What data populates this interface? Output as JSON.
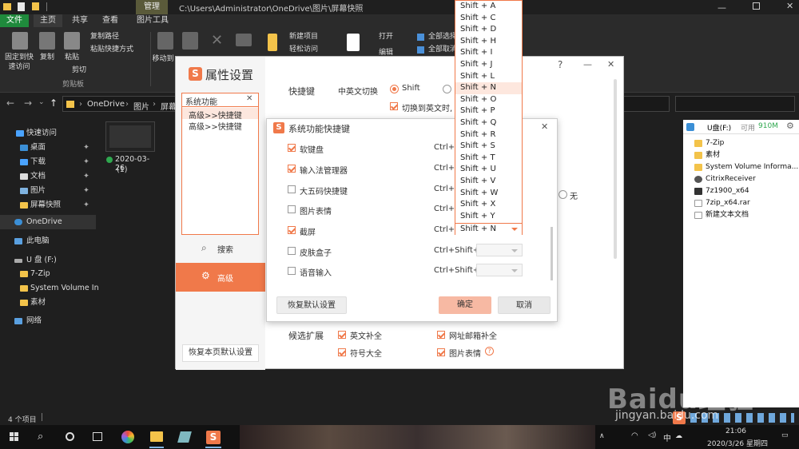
{
  "explorer": {
    "title_path": "C:\\Users\\Administrator\\OneDrive\\图片\\屏幕快照",
    "context_tab": "管理",
    "tabs": [
      "文件",
      "主页",
      "共享",
      "查看",
      "图片工具"
    ],
    "ribbon": {
      "pin_quick": "固定到快\n速访问",
      "copy": "复制",
      "paste": "粘贴",
      "copy_path": "复制路径",
      "paste_shortcut": "粘贴快捷方式",
      "cut": "剪切",
      "group_clipboard": "剪贴板",
      "move_to": "移动到",
      "new_item": "新建项目",
      "easy_access": "轻松访问",
      "open": "打开",
      "edit": "编辑",
      "select_all": "全部选择",
      "select_none": "全部取消"
    },
    "breadcrumb": [
      "OneDrive",
      "图片",
      "屏幕"
    ],
    "nav": {
      "quick_access": "快速访问",
      "desktop": "桌面",
      "downloads": "下载",
      "documents": "文档",
      "pictures": "图片",
      "screenshots": "屏幕快照",
      "onedrive": "OneDrive",
      "this_pc": "此电脑",
      "udisk": "U 盘 (F:)",
      "zip": "7-Zip",
      "svi": "System Volume In",
      "material": "素材",
      "network": "网络"
    },
    "file": {
      "name": "2020-03-26",
      "suffix": "(1)"
    },
    "status": "4 个项目"
  },
  "udisk_panel": {
    "title": "U盘(F:)",
    "free_label": "可用",
    "free": "910M",
    "items": [
      "7-Zip",
      "素材",
      "System Volume Informa...",
      "CitrixReceiver",
      "7z1900_x64",
      "7zip_x64.rar",
      "新建文本文档"
    ]
  },
  "sogou": {
    "title": "属性设置",
    "search_value": "系统功能",
    "results": [
      "高级>>快捷键",
      "高级>>快捷键"
    ],
    "nav_search": "搜索",
    "nav_advanced": "高级",
    "restore_page": "恢复本页默认设置",
    "hotkey_label": "快捷键",
    "switch_label": "中英文切换",
    "shift_option": "Shift",
    "switch_note": "切换到英文时,",
    "none_option": "无",
    "candidate_label": "候选扩展",
    "cand": [
      "英文补全",
      "网址邮箱补全",
      "符号大全",
      "图片表情"
    ],
    "help": "?",
    "minimize": "—",
    "close": "✕"
  },
  "dialog": {
    "title": "系统功能快捷键",
    "close": "✕",
    "rows": [
      {
        "label": "软键盘",
        "checked": true,
        "combo": "Ctrl+S"
      },
      {
        "label": "输入法管理器",
        "checked": true,
        "combo": "Ctrl+S"
      },
      {
        "label": "大五码快捷键",
        "checked": false,
        "combo": "Ctrl+S"
      },
      {
        "label": "图片表情",
        "checked": false,
        "combo": "Ctrl+S"
      },
      {
        "label": "截屏",
        "checked": true,
        "combo": "Ctrl+"
      },
      {
        "label": "皮肤盒子",
        "checked": false,
        "combo": "Ctrl+Shift+"
      },
      {
        "label": "语音输入",
        "checked": false,
        "combo": "Ctrl+Shift+"
      }
    ],
    "selected_value": "Shift + N",
    "restore": "恢复默认设置",
    "ok": "确定",
    "cancel": "取消"
  },
  "dropdown": {
    "options": [
      "Shift + A",
      "Shift + C",
      "Shift + D",
      "Shift + H",
      "Shift + I",
      "Shift + J",
      "Shift + L",
      "Shift + N",
      "Shift + O",
      "Shift + P",
      "Shift + Q",
      "Shift + R",
      "Shift + S",
      "Shift + T",
      "Shift + U",
      "Shift + V",
      "Shift + W",
      "Shift + X",
      "Shift + Y"
    ],
    "highlighted": "Shift + N"
  },
  "taskbar": {
    "ime_tray": "中",
    "time": "21:06",
    "date": "2020/3/26 星期四"
  },
  "watermark": {
    "brand": "Baidu经验",
    "url": "jingyan.baidu.com"
  },
  "colors": {
    "accent": "#f0794a",
    "explorer_bg": "#1f1f1f",
    "dark_ribbon": "#2b2b2b",
    "udisk_free": "#2fa84f"
  }
}
